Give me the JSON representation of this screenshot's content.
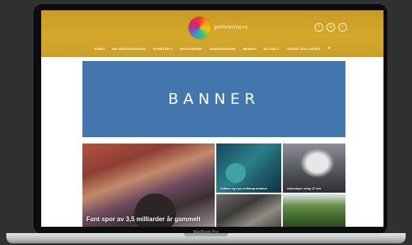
{
  "site": {
    "logo_text": "geoforskning.no"
  },
  "social_icons": [
    {
      "name": "facebook-icon",
      "glyph": "f"
    },
    {
      "name": "instagram-icon",
      "glyph": "◎"
    },
    {
      "name": "twitter-icon",
      "glyph": "t"
    }
  ],
  "nav": {
    "items": [
      {
        "label": "FORSI"
      },
      {
        "label": "OM GEOFORSKNING"
      },
      {
        "label": "NYHETER ▾"
      },
      {
        "label": "GEOTURISME"
      },
      {
        "label": "UNDERVISNING"
      },
      {
        "label": "MENING"
      },
      {
        "label": "AKTUELT"
      },
      {
        "label": "LEDIGE STILLINGER"
      }
    ]
  },
  "banner": {
    "text": "BANNER",
    "color": "#4276ad"
  },
  "articles": {
    "main": {
      "title": "Fant spor av 3,5 milliarder år gammelt"
    },
    "second": {
      "title": "Vulkan og nye vulkanprodukter"
    },
    "third": {
      "title": "Askeskyer stieg 37 km"
    }
  },
  "device": {
    "label": "MacBook Pro"
  },
  "colors": {
    "header": "#d4a82b",
    "background": "#2f3032"
  }
}
